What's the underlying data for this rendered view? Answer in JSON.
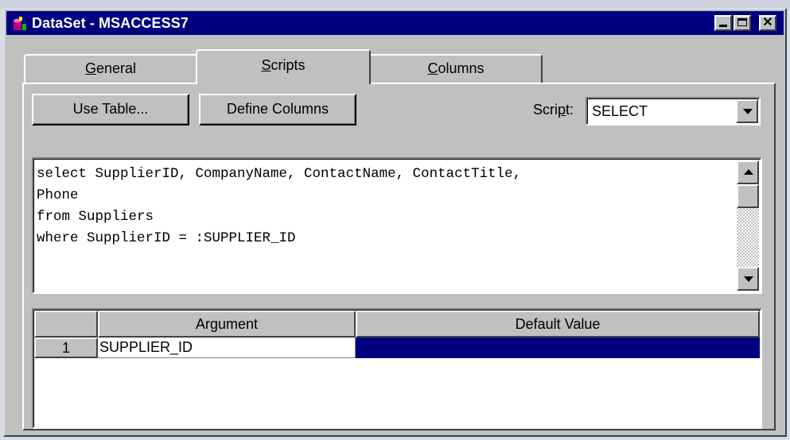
{
  "window": {
    "title": "DataSet - MSACCESS7",
    "controls": {
      "minimize": "minimize",
      "maximize": "maximize",
      "close": "✕"
    }
  },
  "tabs": [
    {
      "label": "General",
      "accel": "G",
      "rest": "eneral",
      "active": false
    },
    {
      "label": "Scripts",
      "accel": "S",
      "rest": "cripts",
      "active": true
    },
    {
      "label": "Columns",
      "accel": "C",
      "rest": "olumns",
      "active": false
    }
  ],
  "toolbar": {
    "use_table_label": "Use Table...",
    "define_columns_label": "Define Columns"
  },
  "script_selector": {
    "label_pre": "Scri",
    "label_accel": "p",
    "label_post": "t:",
    "selected": "SELECT"
  },
  "editor": {
    "text": "select SupplierID, CompanyName, ContactName, ContactTitle,\nPhone\nfrom Suppliers\nwhere SupplierID = :SUPPLIER_ID"
  },
  "arguments_grid": {
    "columns": [
      "Argument",
      "Default Value"
    ],
    "rows": [
      {
        "num": "1",
        "argument": "SUPPLIER_ID",
        "default_value": ""
      }
    ]
  },
  "colors": {
    "title_bar": "#000080",
    "selection": "#000080",
    "face": "#c0c0c0"
  }
}
